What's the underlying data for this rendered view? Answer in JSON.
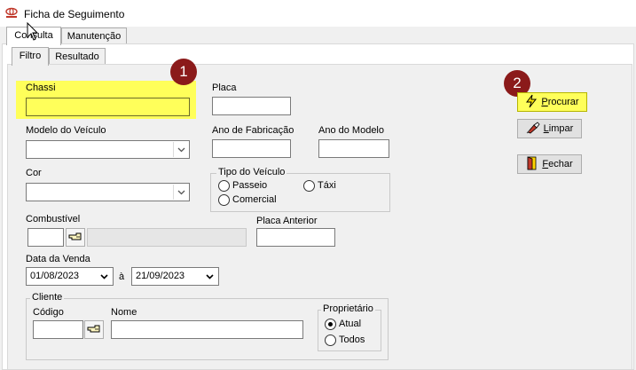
{
  "window": {
    "title": "Ficha de Seguimento"
  },
  "tabs_main": [
    {
      "label": "Consulta",
      "active": true
    },
    {
      "label": "Manutenção",
      "active": false
    }
  ],
  "tabs_sub": [
    {
      "label": "Filtro",
      "active": true
    },
    {
      "label": "Resultado",
      "active": false
    }
  ],
  "fields": {
    "chassi": {
      "label": "Chassi",
      "value": ""
    },
    "placa": {
      "label": "Placa",
      "value": ""
    },
    "modelo": {
      "label": "Modelo do Veículo",
      "value": ""
    },
    "ano_fabricacao": {
      "label": "Ano de Fabricação",
      "value": ""
    },
    "ano_modelo": {
      "label": "Ano do Modelo",
      "value": ""
    },
    "cor": {
      "label": "Cor",
      "value": ""
    },
    "combustivel": {
      "label": "Combustível",
      "value": ""
    },
    "placa_anterior": {
      "label": "Placa Anterior",
      "value": ""
    },
    "data_venda": {
      "label": "Data da Venda",
      "from": "01/08/2023",
      "separator": "à",
      "to": "21/09/2023"
    }
  },
  "tipo_veiculo": {
    "title": "Tipo do Veículo",
    "options": [
      "Passeio",
      "Táxi",
      "Comercial"
    ]
  },
  "cliente": {
    "title": "Cliente",
    "codigo_label": "Código",
    "nome_label": "Nome",
    "proprietario": {
      "title": "Proprietário",
      "options": [
        "Atual",
        "Todos"
      ],
      "selected": "Atual"
    }
  },
  "buttons": {
    "procurar": {
      "underlined": "P",
      "rest": "rocurar"
    },
    "limpar": {
      "underlined": "L",
      "rest": "impar"
    },
    "fechar": {
      "underlined": "F",
      "rest": "echar"
    }
  },
  "annotations": [
    "1",
    "2"
  ],
  "colors": {
    "highlight": "#ffff5a",
    "badge": "#8b1a1a"
  }
}
